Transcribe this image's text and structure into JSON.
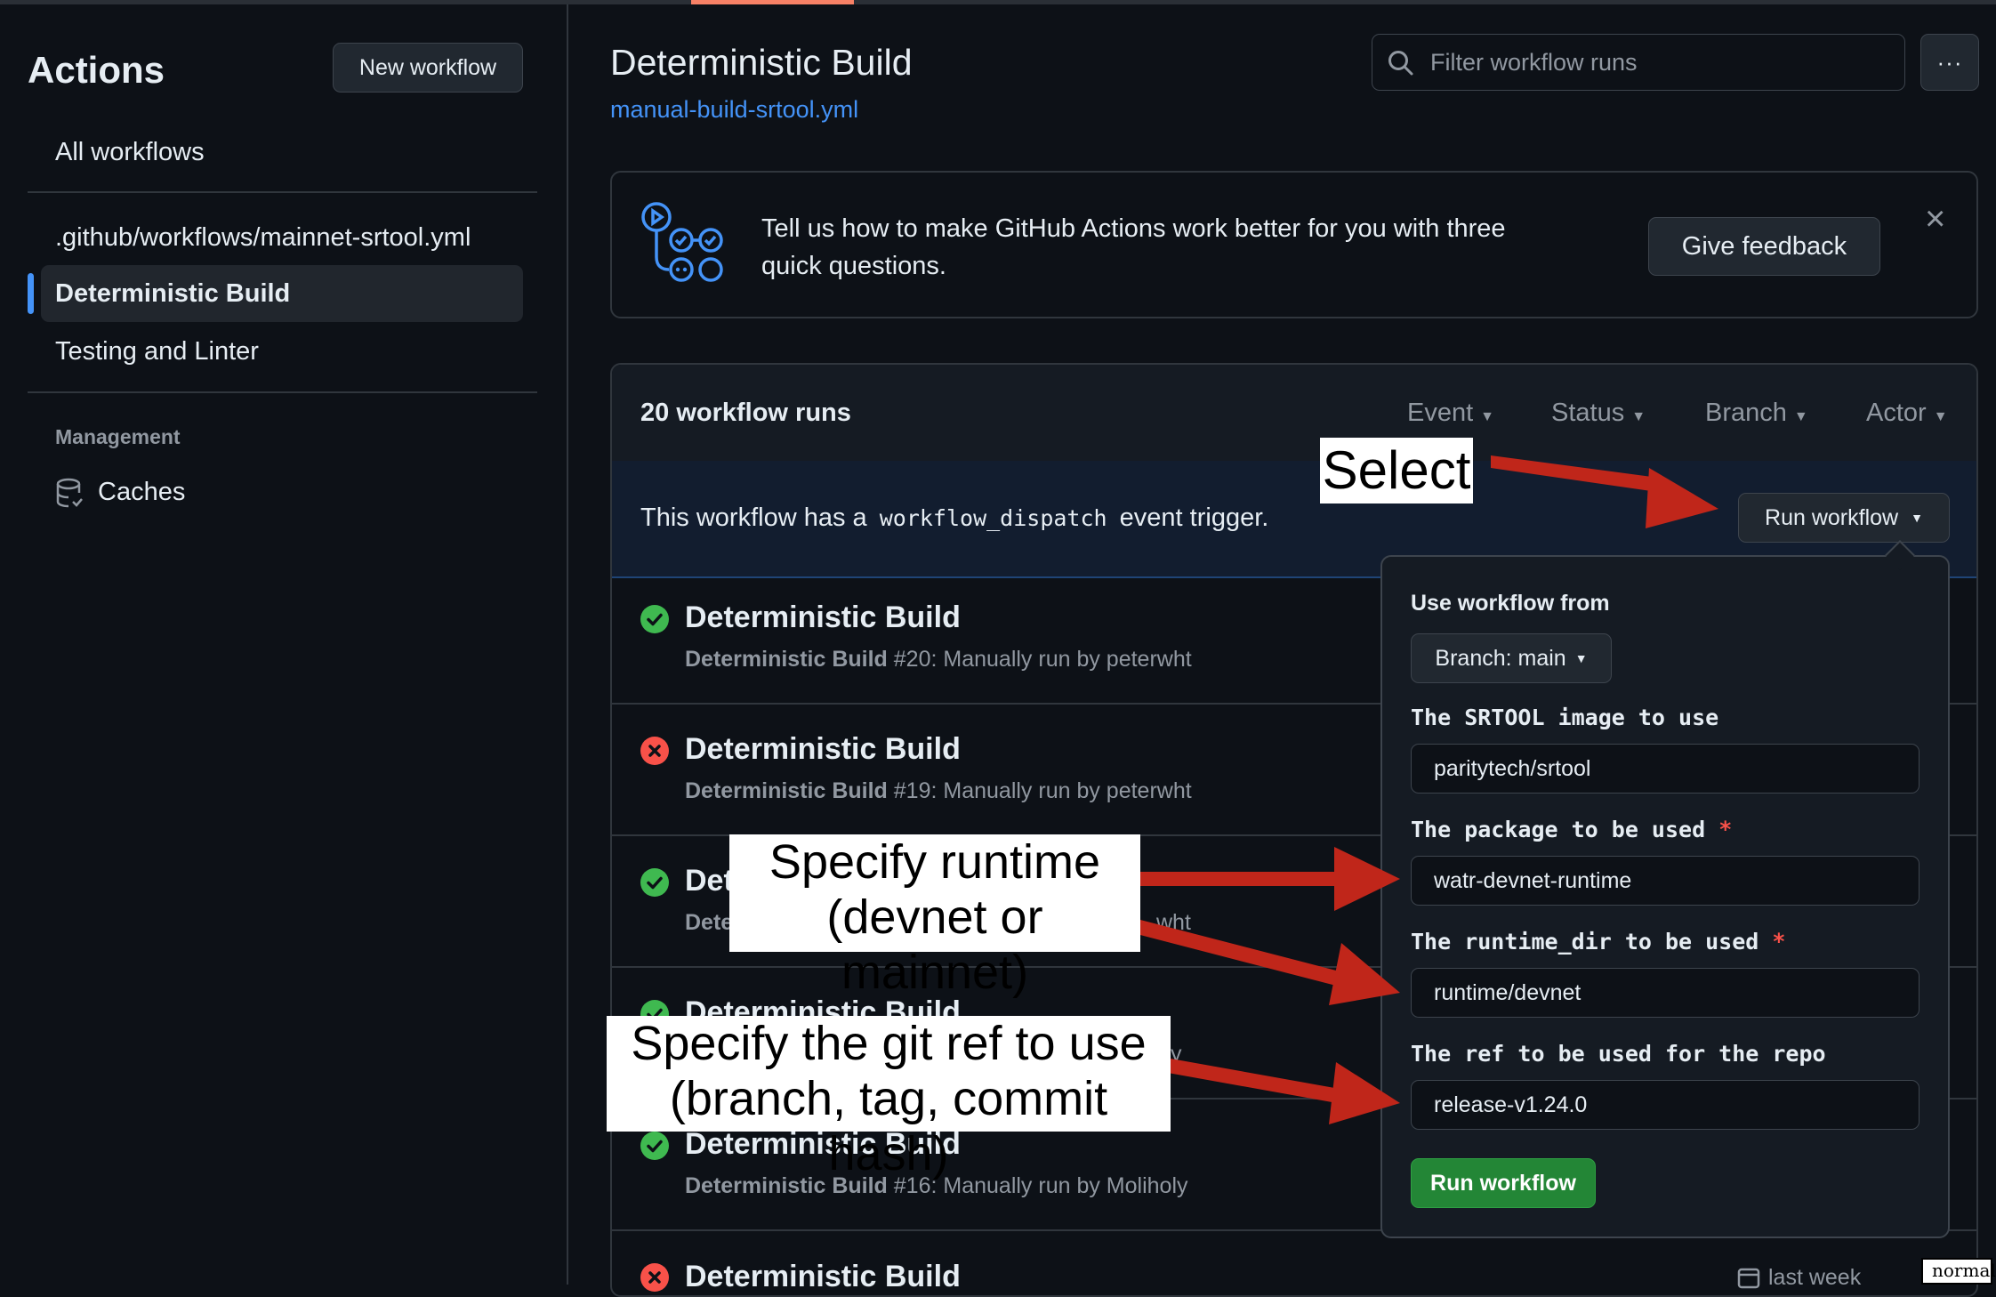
{
  "sidebar": {
    "title": "Actions",
    "new_workflow": "New workflow",
    "all_workflows": "All workflows",
    "items": [
      {
        "label": ".github/workflows/mainnet-srtool.yml"
      },
      {
        "label": "Deterministic Build"
      },
      {
        "label": "Testing and Linter"
      }
    ],
    "management_heading": "Management",
    "caches": "Caches"
  },
  "header": {
    "title": "Deterministic Build",
    "file_link": "manual-build-srtool.yml",
    "search_placeholder": "Filter workflow runs",
    "more_label": "···"
  },
  "feedback": {
    "text": "Tell us how to make GitHub Actions work better for you with three quick questions.",
    "button": "Give feedback",
    "close": "×"
  },
  "runs": {
    "count_label": "20 workflow runs",
    "filters": [
      "Event",
      "Status",
      "Branch",
      "Actor"
    ],
    "dispatch_prefix": "This workflow has a",
    "dispatch_code": "workflow_dispatch",
    "dispatch_suffix": "event trigger.",
    "run_workflow_button": "Run workflow",
    "rows": [
      {
        "status": "success",
        "title": "Deterministic Build",
        "name": "Deterministic Build",
        "detail": "#20: Manually run by peterwht"
      },
      {
        "status": "failure",
        "title": "Deterministic Build",
        "name": "Deterministic Build",
        "detail": "#19: Manually run by peterwht"
      },
      {
        "status": "success",
        "title": "Det",
        "name": "Dete",
        "detail": "wht"
      },
      {
        "status": "success",
        "title": "Deterministic Build",
        "name": "",
        "detail": "y"
      },
      {
        "status": "success",
        "title": "Deterministic Build",
        "name": "Deterministic Build",
        "detail": "#16: Manually run by Moliholy"
      },
      {
        "status": "failure",
        "title": "Deterministic Build",
        "name": "",
        "detail": ""
      }
    ],
    "last_row_time": "last week",
    "corner_tag": "normal"
  },
  "dispatch_form": {
    "use_from_label": "Use workflow from",
    "branch_button": "Branch: main",
    "fields": [
      {
        "label": "The SRTOOL image to use",
        "required": false,
        "value": "paritytech/srtool"
      },
      {
        "label": "The package to be used",
        "required": true,
        "value": "watr-devnet-runtime"
      },
      {
        "label": "The runtime_dir to be used",
        "required": true,
        "value": "runtime/devnet"
      },
      {
        "label": "The ref to be used for the repo",
        "required": false,
        "value": "release-v1.24.0"
      }
    ],
    "required_mark": "*",
    "submit": "Run workflow"
  },
  "annotations": {
    "select": "Select",
    "runtime_line1": "Specify runtime",
    "runtime_line2": "(devnet or mainnet)",
    "ref_line1": "Specify the git ref to use",
    "ref_line2": "(branch, tag, commit hash)",
    "arrow_color": "#c0261a"
  },
  "colors": {
    "bg": "#0d1117",
    "accent_blue": "#4493f8",
    "success": "#3fb950",
    "failure": "#f85149",
    "primary_green": "#238636"
  }
}
